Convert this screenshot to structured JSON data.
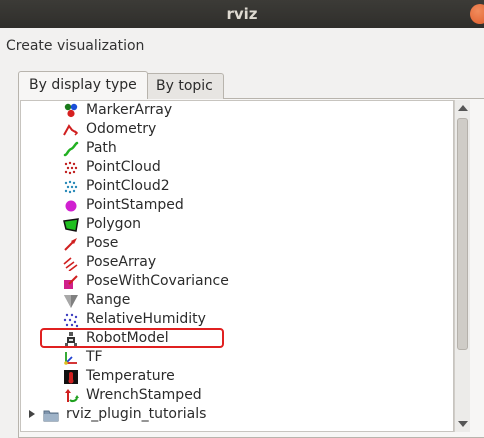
{
  "window": {
    "title": "rviz"
  },
  "dialog": {
    "section_label": "Create visualization"
  },
  "tabs": [
    {
      "label": "By display type",
      "active": true
    },
    {
      "label": "By topic",
      "active": false
    }
  ],
  "list": {
    "items": [
      {
        "label": "MarkerArray",
        "icon": "marker-array-icon"
      },
      {
        "label": "Odometry",
        "icon": "odometry-icon"
      },
      {
        "label": "Path",
        "icon": "path-icon"
      },
      {
        "label": "PointCloud",
        "icon": "pointcloud-icon"
      },
      {
        "label": "PointCloud2",
        "icon": "pointcloud2-icon"
      },
      {
        "label": "PointStamped",
        "icon": "point-stamped-icon"
      },
      {
        "label": "Polygon",
        "icon": "polygon-icon"
      },
      {
        "label": "Pose",
        "icon": "pose-icon"
      },
      {
        "label": "PoseArray",
        "icon": "pose-array-icon"
      },
      {
        "label": "PoseWithCovariance",
        "icon": "pose-covariance-icon"
      },
      {
        "label": "Range",
        "icon": "range-icon"
      },
      {
        "label": "RelativeHumidity",
        "icon": "relative-humidity-icon"
      },
      {
        "label": "RobotModel",
        "icon": "robot-model-icon",
        "highlighted": true
      },
      {
        "label": "TF",
        "icon": "tf-icon"
      },
      {
        "label": "Temperature",
        "icon": "temperature-icon"
      },
      {
        "label": "WrenchStamped",
        "icon": "wrench-stamped-icon"
      }
    ],
    "folder": {
      "label": "rviz_plugin_tutorials",
      "icon": "folder-icon"
    }
  },
  "colors": {
    "highlight": "#e02020",
    "titlebar": "#3c3b37",
    "close_button": "#e05c2a"
  }
}
